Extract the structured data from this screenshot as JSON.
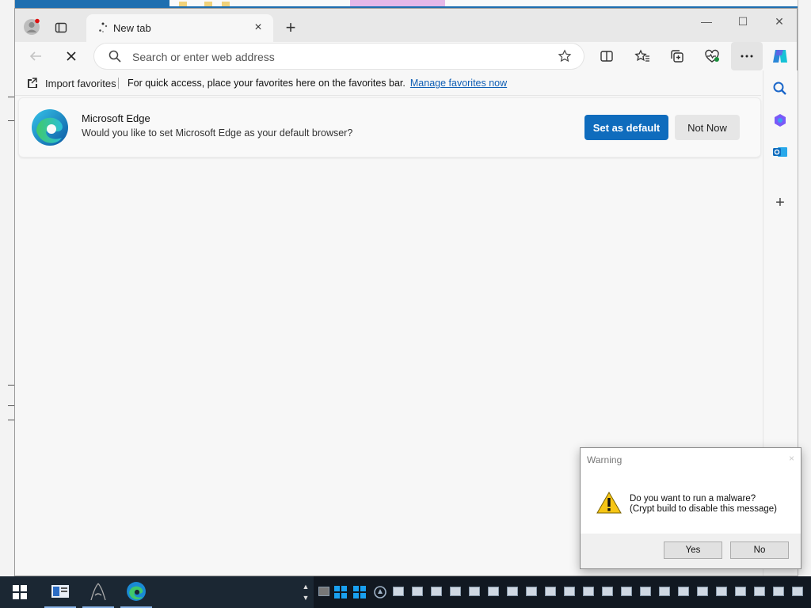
{
  "browser": {
    "tab": {
      "title": "New tab",
      "close_label": "×"
    },
    "new_tab_label": "+",
    "window_controls": {
      "minimize": "—",
      "maximize": "☐",
      "close": "✕"
    },
    "address": {
      "placeholder": "Search or enter web address",
      "value": ""
    },
    "icons": [
      "profile-icon",
      "tab-actions-icon",
      "back-icon",
      "stop-icon",
      "search-icon",
      "favorite-star-icon",
      "split-screen-icon",
      "favorites-icon",
      "collections-icon",
      "browser-essentials-icon",
      "more-icon",
      "copilot-icon"
    ]
  },
  "favorites_bar": {
    "import_label": "Import favorites",
    "message": "For quick access, place your favorites here on the favorites bar.",
    "link": "Manage favorites now"
  },
  "default_banner": {
    "app_name": "Microsoft Edge",
    "question": "Would you like to set Microsoft Edge as your default browser?",
    "primary_button": "Set as default",
    "secondary_button": "Not Now"
  },
  "sidebar": {
    "add_label": "+"
  },
  "dialog": {
    "title": "Warning",
    "close": "×",
    "line1": "Do you want to run a malware?",
    "line2": "(Crypt build to disable this message)",
    "yes": "Yes",
    "no": "No"
  },
  "colors": {
    "accent": "#0f6cbd",
    "taskbar": "#1b2733"
  }
}
